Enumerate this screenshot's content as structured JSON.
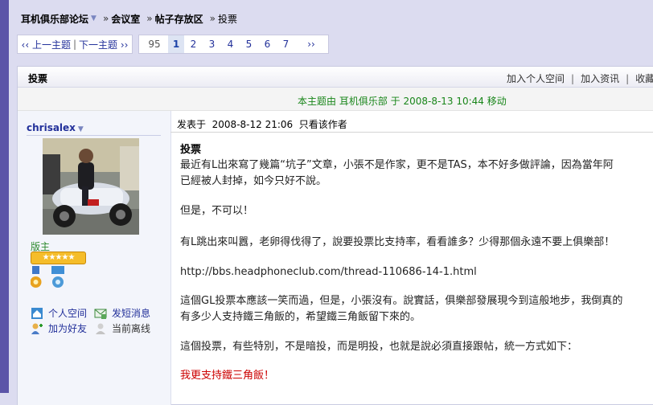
{
  "breadcrumb": {
    "forum": "耳机俱乐部论坛",
    "section1": "会议室",
    "section2": "帖子存放区",
    "current": "投票",
    "sep": "»"
  },
  "nav": {
    "prev": "‹‹ 上一主题",
    "next": "下一主题 ››",
    "pipe": "|"
  },
  "pagination": {
    "first": "95",
    "current": "1",
    "pages": [
      "2",
      "3",
      "4",
      "5",
      "6",
      "7"
    ],
    "next": "››"
  },
  "thread": {
    "title": "投票",
    "links": [
      "加入个人空间",
      "加入资讯",
      "收藏"
    ],
    "notice": "本主题由 耳机俱乐部 于 2008-8-13 10:44 移动"
  },
  "author": {
    "name": "chrisalex",
    "role": "版主",
    "stars": "★★★★★",
    "actions": {
      "space": "个人空间",
      "message": "发短消息",
      "friend": "加为好友",
      "status": "当前离线"
    }
  },
  "post": {
    "posted_label": "发表于",
    "date": "2008-8-12 21:06",
    "author_only": "只看该作者",
    "title": "投票",
    "lines": [
      "最近有L出來寫了幾篇“坑子”文章，小張不是作家，更不是TAS，本不好多做評論，因為當年阿",
      "已經被人封掉，如今只好不說。",
      "但是，不可以！",
      "有L跳出來叫囂，老卵得伐得了，說要投票比支持率，看看誰多？少得那個永遠不要上俱樂部！",
      "http://bbs.headphoneclub.com/thread-110686-14-1.html",
      "這個GL投票本應該一笑而過，但是，小張沒有。說實話，俱樂部發展現今到這般地步，我倒真的",
      "有多少人支持鐵三角飯的，希望鐵三角飯留下來的。",
      "這個投票，有些特別，不是暗投，而是明投，也就是說必須直接跟帖，統一方式如下：",
      "我更支持鐵三角飯！"
    ]
  },
  "colors": {
    "link": "#22309a",
    "notice": "#19861a",
    "accent_red": "#cc0000",
    "left_bar": "#5b54a8",
    "page_bg": "#dcdcf0"
  }
}
